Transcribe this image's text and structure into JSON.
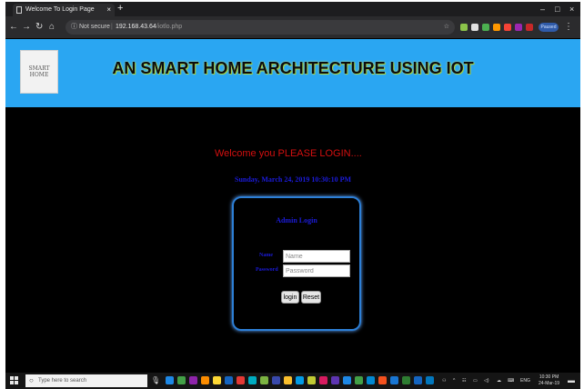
{
  "browser": {
    "tab_title": "Welcome To Login Page",
    "tab_close": "×",
    "new_tab": "+",
    "url_security": "Not secure",
    "url_separator": "|",
    "url_host": "192.168.43.64",
    "url_path": "/iotlo.php",
    "paused_label": "Paused"
  },
  "header": {
    "logo_text": "SMART HOME",
    "title": "AN SMART HOME ARCHITECTURE USING IOT",
    "bg_color": "#2aa6f2"
  },
  "page": {
    "welcome": "Welcome you PLEASE LOGIN....",
    "datetime": "Sunday, March 24, 2019 10:30:10 PM"
  },
  "login": {
    "title": "Admin Login",
    "name_label": "Name",
    "name_placeholder": "Name",
    "password_label": "Password",
    "password_placeholder": "Password",
    "login_button": "login",
    "reset_button": "Reset"
  },
  "taskbar": {
    "search_placeholder": "Type here to search",
    "language": "ENG",
    "time": "10:30 PM",
    "date": "24-Mar-19"
  }
}
